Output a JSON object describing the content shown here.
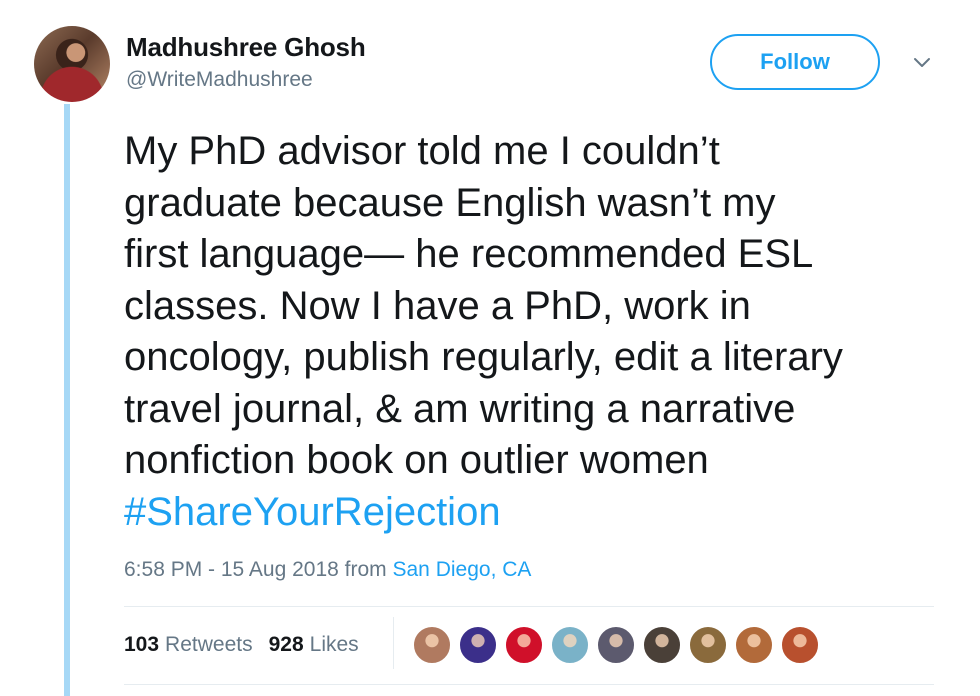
{
  "user": {
    "name": "Madhushree Ghosh",
    "handle": "@WriteMadhushree"
  },
  "follow_label": "Follow",
  "tweet": {
    "lines": [
      "My PhD advisor told me I couldn’t",
      "graduate because English wasn’t my",
      "first language— he recommended ESL",
      "classes. Now I have a PhD, work in",
      "oncology, publish regularly, edit a literary",
      "travel journal, & am writing a narrative",
      "nonfiction book on outlier women"
    ],
    "hashtag": "#ShareYourRejection"
  },
  "meta": {
    "time": "6:58 PM - 15 Aug 2018 from ",
    "location": "San Diego, CA"
  },
  "stats": {
    "retweets_count": "103",
    "retweets_label": "Retweets",
    "likes_count": "928",
    "likes_label": "Likes"
  },
  "colors": {
    "accent": "#1da1f2",
    "thread_line": "#a6d8f6",
    "muted": "#657786"
  },
  "liker_avatars": [
    {
      "color": "#b07a60"
    },
    {
      "color": "#3b2f8a"
    },
    {
      "color": "#d0102a"
    },
    {
      "color": "#7ab2c8"
    },
    {
      "color": "#5c5a6e"
    },
    {
      "color": "#4a4038"
    },
    {
      "color": "#8a6a3c"
    },
    {
      "color": "#b26a3a"
    },
    {
      "color": "#b8502e"
    }
  ]
}
